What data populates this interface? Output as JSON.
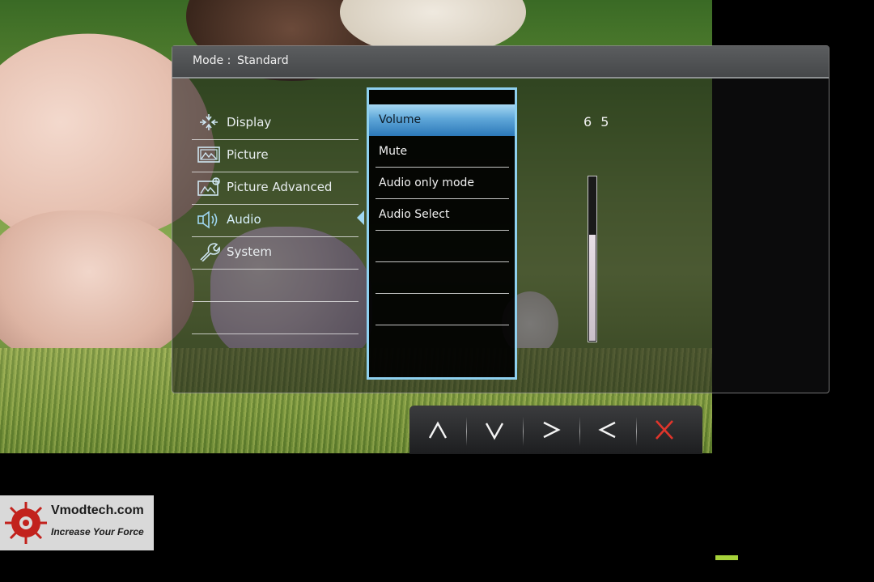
{
  "osd": {
    "header": {
      "mode_label": "Mode :",
      "mode_value": "Standard"
    },
    "menu": [
      {
        "label": "Display",
        "icon": "display-icon"
      },
      {
        "label": "Picture",
        "icon": "picture-icon"
      },
      {
        "label": "Picture Advanced",
        "icon": "picture-advanced-icon"
      },
      {
        "label": "Audio",
        "icon": "audio-icon",
        "active": true
      },
      {
        "label": "System",
        "icon": "system-wrench-icon"
      }
    ],
    "submenu": [
      {
        "label": "Volume",
        "selected": true
      },
      {
        "label": "Mute"
      },
      {
        "label": "Audio only mode"
      },
      {
        "label": "Audio Select"
      }
    ],
    "volume": {
      "value": "6 5",
      "level": 65
    },
    "accent_color": "#8ed0ef"
  },
  "controls": {
    "buttons": [
      {
        "icon": "up-arrow-icon",
        "glyph": "∧"
      },
      {
        "icon": "down-arrow-icon",
        "glyph": "∨"
      },
      {
        "icon": "right-arrow-icon",
        "glyph": ">"
      },
      {
        "icon": "left-arrow-icon",
        "glyph": "<"
      },
      {
        "icon": "close-x-icon",
        "color": "#e0352b"
      }
    ]
  },
  "watermark": {
    "title": "Vmodtech.com",
    "subtitle": "Increase Your Force"
  }
}
